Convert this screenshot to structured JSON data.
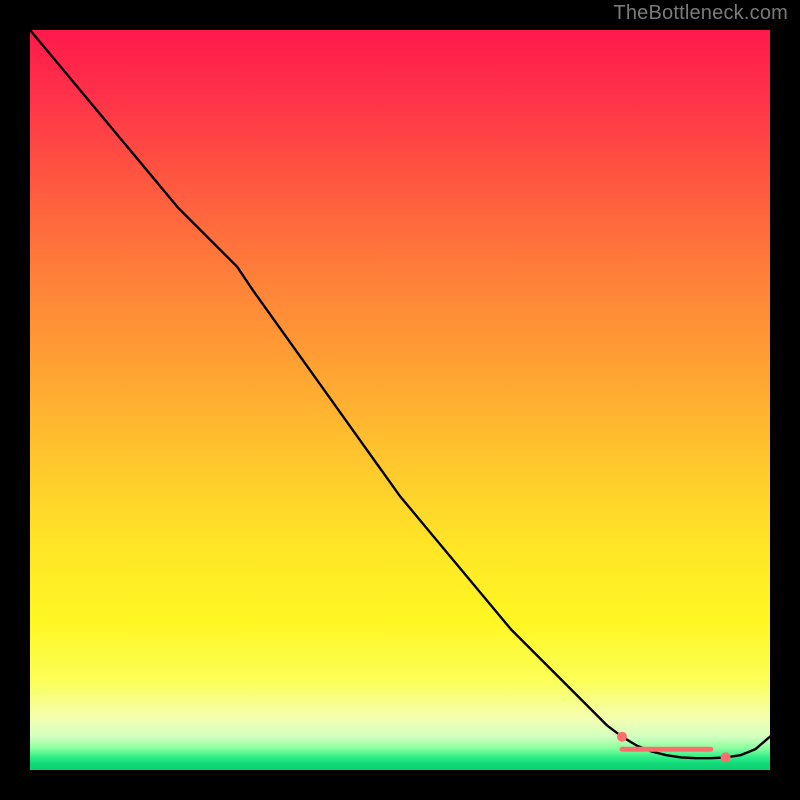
{
  "watermark": "TheBottleneck.com",
  "chart_data": {
    "type": "line",
    "title": "",
    "xlabel": "",
    "ylabel": "",
    "xlim": [
      0,
      100
    ],
    "ylim": [
      0,
      100
    ],
    "grid": false,
    "legend": false,
    "series": [
      {
        "name": "curve",
        "color": "#000000",
        "x": [
          0,
          5,
          10,
          15,
          20,
          25,
          28,
          30,
          35,
          40,
          45,
          50,
          55,
          60,
          65,
          70,
          75,
          78,
          80,
          82,
          84,
          86,
          88,
          90,
          92,
          94,
          96,
          98,
          100
        ],
        "y": [
          100,
          94,
          88,
          82,
          76,
          71,
          68,
          65,
          58,
          51,
          44,
          37,
          31,
          25,
          19,
          14,
          9,
          6,
          4.5,
          3.3,
          2.5,
          2.0,
          1.7,
          1.6,
          1.6,
          1.7,
          2.0,
          2.8,
          4.5
        ]
      }
    ],
    "markers": [
      {
        "name": "trough-left",
        "x": 80,
        "y": 4.5,
        "color": "#ff6d6d",
        "r": 5
      },
      {
        "name": "trough-right",
        "x": 94,
        "y": 1.7,
        "color": "#ff6d6d",
        "r": 5
      }
    ],
    "highlight_band": {
      "name": "trough-band",
      "x0": 80,
      "x1": 92,
      "y": 2.8,
      "color": "#ff6d6d",
      "thickness": 5
    }
  }
}
